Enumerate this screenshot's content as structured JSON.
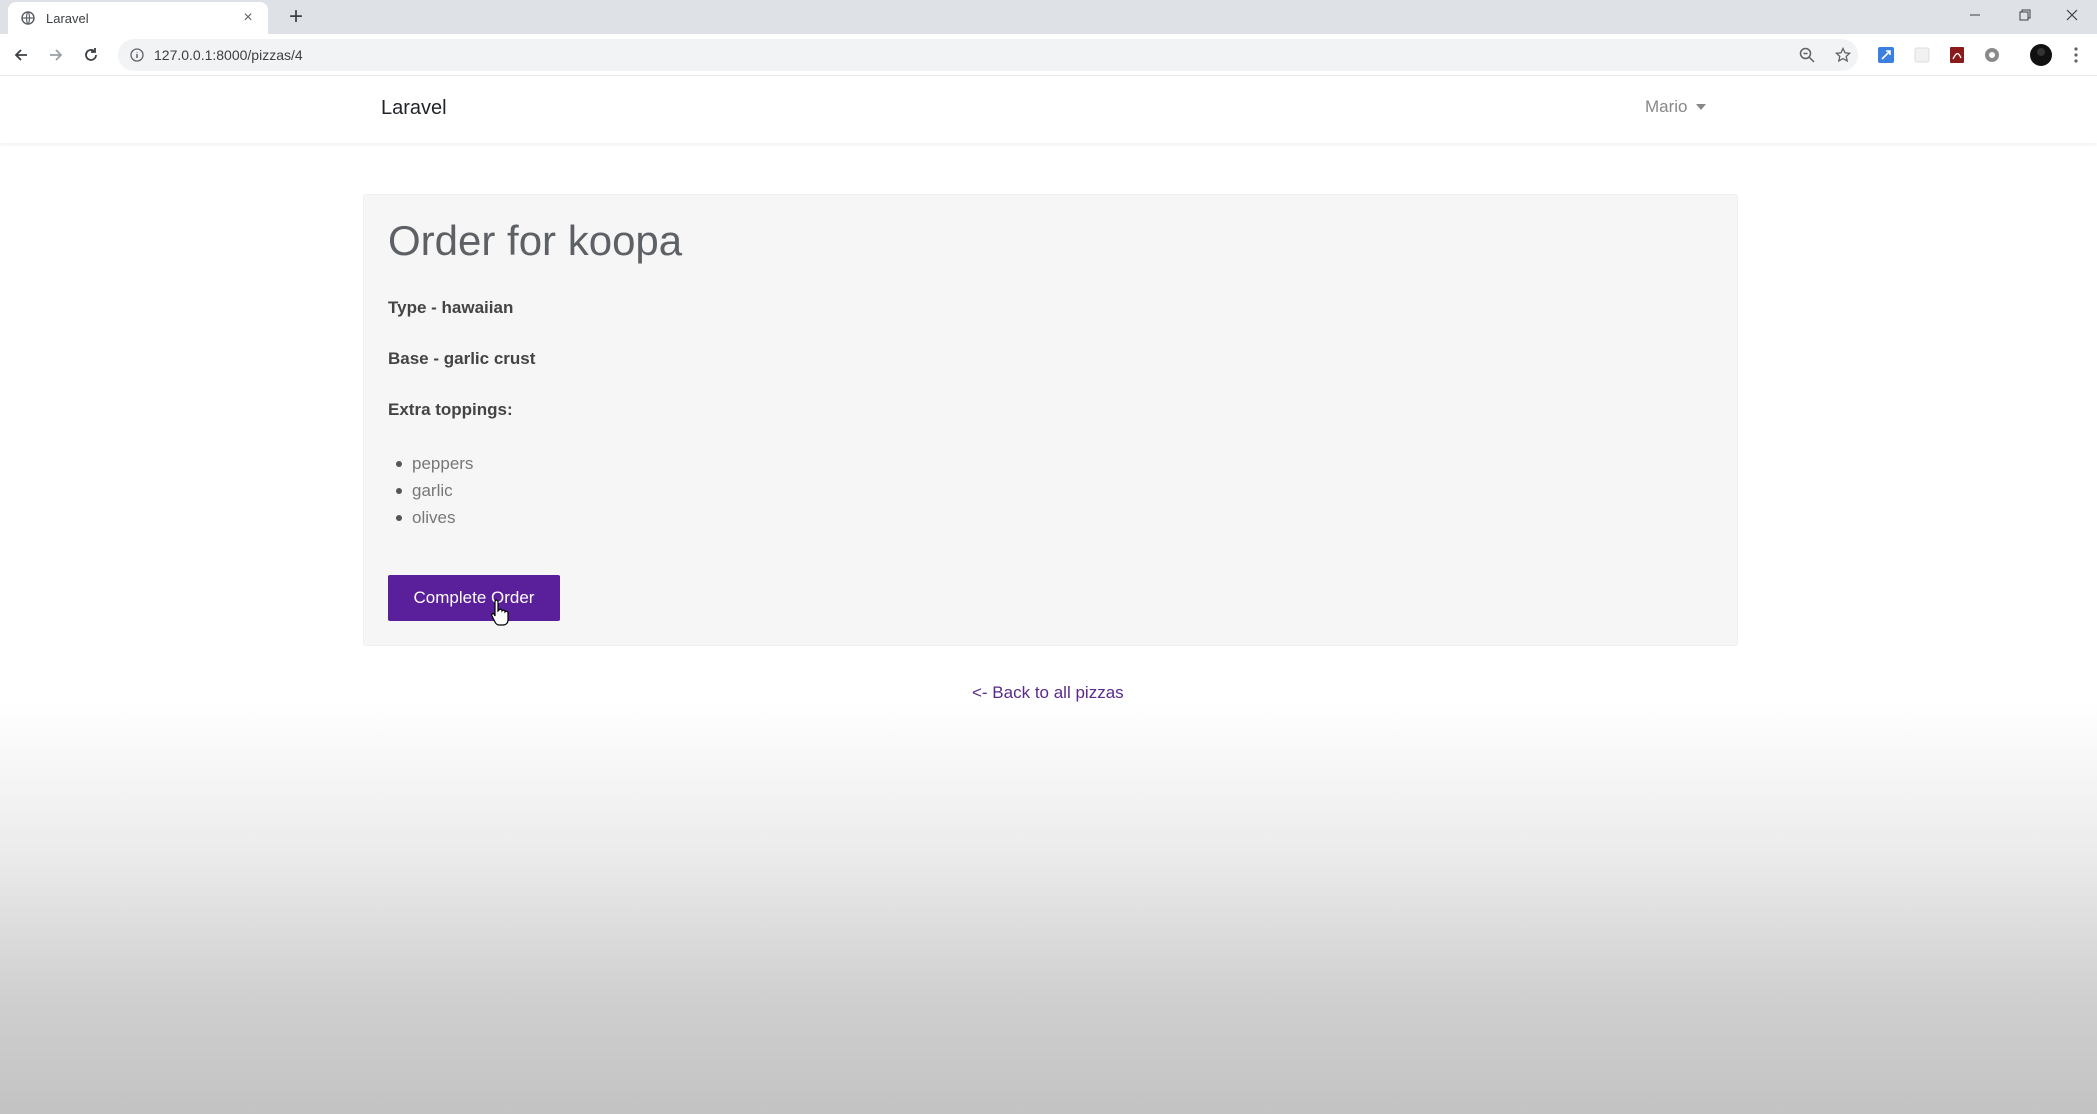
{
  "browser": {
    "tab_title": "Laravel",
    "tab_close": "×",
    "new_tab": "+",
    "url": "127.0.0.1:8000/pizzas/4",
    "icons": [
      "globe-icon",
      "back-icon",
      "forward-icon",
      "reload-icon",
      "info-icon",
      "zoom-icon",
      "star-icon",
      "extension-icon",
      "profile-icon",
      "menu-icon"
    ]
  },
  "navbar": {
    "brand": "Laravel",
    "user": "Mario"
  },
  "order": {
    "title": "Order for koopa",
    "type": "Type - hawaiian",
    "base": "Base - garlic crust",
    "toppings_label": "Extra toppings:",
    "toppings": [
      "peppers",
      "garlic",
      "olives"
    ],
    "complete_label": "Complete Order"
  },
  "back_link": "<- Back to all pizzas",
  "colors": {
    "button": "#5a1f9a",
    "link": "#5a2a8a"
  }
}
